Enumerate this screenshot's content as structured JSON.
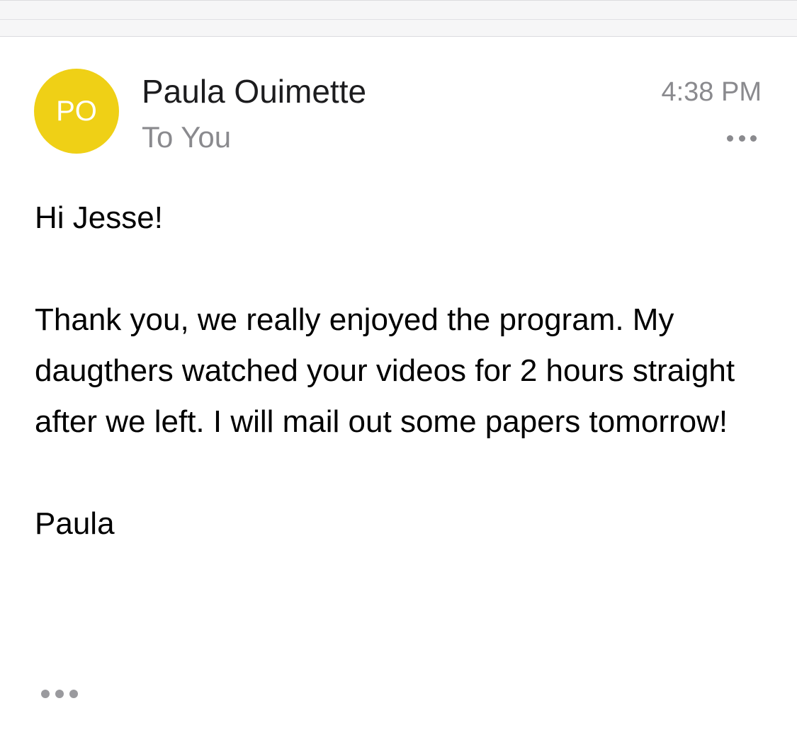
{
  "email": {
    "sender_initials": "PO",
    "sender_name": "Paula Ouimette",
    "recipient": "To You",
    "time": "4:38 PM",
    "body": {
      "greeting": "Hi Jesse!",
      "paragraph": "Thank you, we really enjoyed the program. My daugthers watched your videos for 2 hours straight after we left. I will mail out some papers tomorrow!",
      "signature": "Paula"
    }
  },
  "colors": {
    "avatar_bg": "#efd016",
    "secondary_text": "#8a8a8e",
    "primary_text": "#1c1c1e"
  },
  "icons": {
    "header_more": "more-horizontal-icon",
    "footer_more": "more-horizontal-icon"
  }
}
